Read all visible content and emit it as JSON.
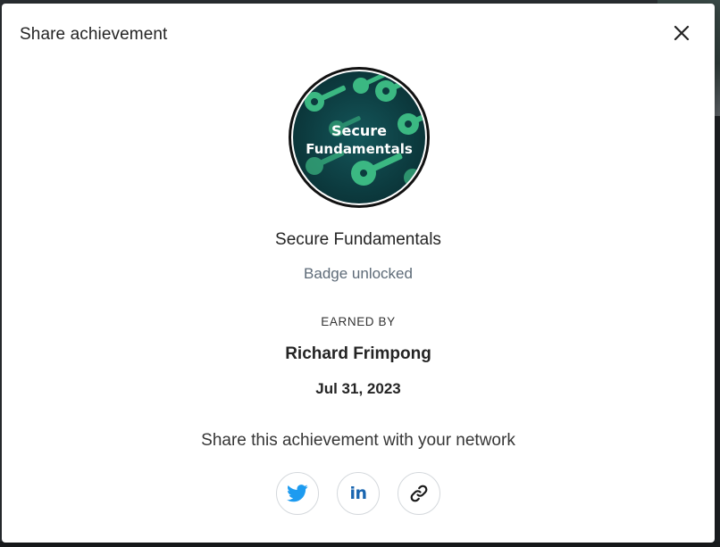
{
  "modal": {
    "title": "Share achievement",
    "close_icon": "close-icon"
  },
  "badge": {
    "image_text_line1": "Secure",
    "image_text_line2": "Fundamentals",
    "name": "Secure Fundamentals",
    "status": "Badge unlocked"
  },
  "earned": {
    "label": "EARNED BY",
    "name": "Richard Frimpong",
    "date": "Jul 31, 2023"
  },
  "share": {
    "prompt": "Share this achievement with your network",
    "buttons": [
      {
        "icon": "twitter-icon"
      },
      {
        "icon": "linkedin-icon",
        "glyph": "in"
      },
      {
        "icon": "link-icon"
      }
    ]
  },
  "colors": {
    "twitter": "#1d9bf0",
    "linkedin": "#1a66b0",
    "badge_bg": "#0d3b3f",
    "badge_keys": "#3fbf86"
  }
}
